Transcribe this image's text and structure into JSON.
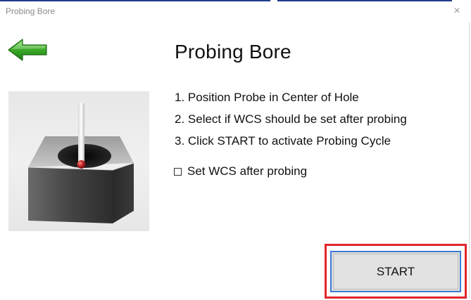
{
  "window": {
    "title": "Probing Bore",
    "close_glyph": "✕"
  },
  "header": {
    "back_icon": "green-back-arrow-icon",
    "title": "Probing Bore"
  },
  "instructions": [
    "1. Position Probe in Center of Hole",
    "2. Select if WCS should be set after probing",
    "3. Click START to activate Probing Cycle"
  ],
  "option": {
    "label": "Set WCS after probing",
    "checked": false
  },
  "actions": {
    "start_label": "START"
  },
  "colors": {
    "back_arrow": "#3fae2a",
    "highlight": "#e0262c",
    "focus_border": "#3d7ad4",
    "probe_ball": "#c0282a"
  }
}
